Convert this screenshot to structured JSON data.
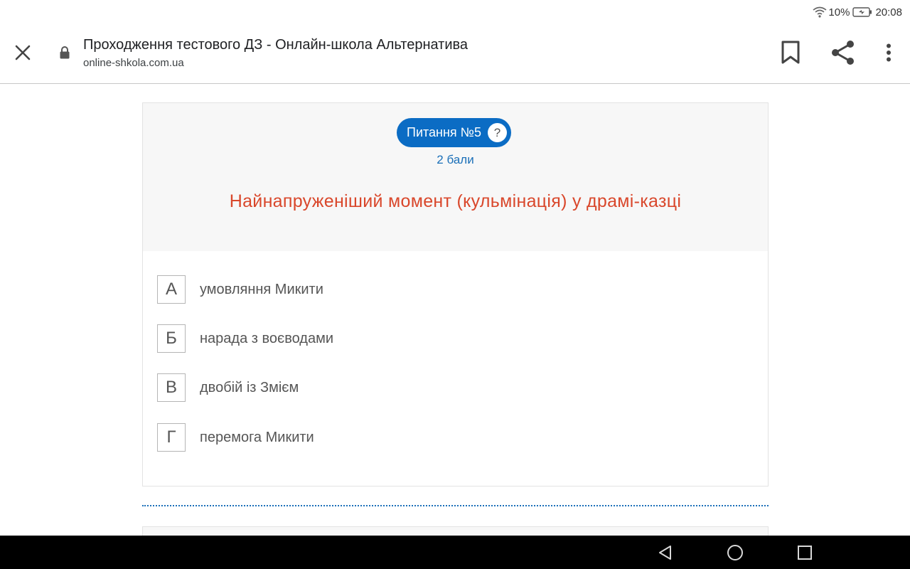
{
  "status": {
    "battery": "10%",
    "time": "20:08"
  },
  "browser": {
    "title": "Проходження тестового ДЗ - Онлайн-школа Альтернатива",
    "url": "online-shkola.com.ua"
  },
  "question": {
    "badge": "Питання №5",
    "help": "?",
    "points": "2 бали",
    "text": "Найнапруженіший момент (кульмінація) у драмі-казці",
    "answers": [
      {
        "letter": "А",
        "label": "умовляння Микити"
      },
      {
        "letter": "Б",
        "label": "нарада з воєводами"
      },
      {
        "letter": "В",
        "label": "двобій із Змієм"
      },
      {
        "letter": "Г",
        "label": "перемога Микити"
      }
    ]
  },
  "colors": {
    "accent": "#0b6cc4",
    "question_text": "#d9472b",
    "points_text": "#1a6fb8"
  }
}
